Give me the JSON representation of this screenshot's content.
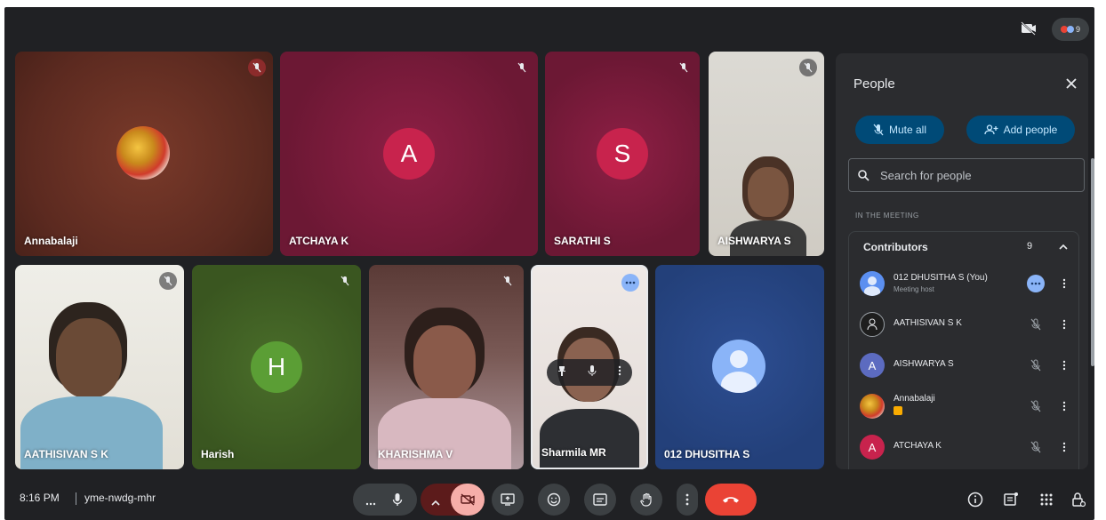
{
  "meeting": {
    "time": "8:16 PM",
    "code": "yme-nwdg-mhr"
  },
  "top": {
    "participant_count": "9"
  },
  "tiles": [
    {
      "name": "Annabalaji"
    },
    {
      "name": "ATCHAYA K",
      "initial": "A"
    },
    {
      "name": "SARATHI S",
      "initial": "S"
    },
    {
      "name": "AISHWARYA S"
    },
    {
      "name": "AATHISIVAN S K"
    },
    {
      "name": "Harish",
      "initial": "H"
    },
    {
      "name": "KHARISHMA V"
    },
    {
      "name": "Sharmila MR"
    },
    {
      "name": "012 DHUSITHA S"
    }
  ],
  "panel": {
    "title": "People",
    "mute_all": "Mute all",
    "add_people": "Add people",
    "search_placeholder": "Search for people",
    "section_label": "IN THE MEETING",
    "contributors_label": "Contributors",
    "contributors_count": "9",
    "people": [
      {
        "name": "012 DHUSITHA S (You)",
        "subtitle": "Meeting host"
      },
      {
        "name": "AATHISIVAN S K"
      },
      {
        "name": "AISHWARYA S",
        "initial": "A"
      },
      {
        "name": "Annabalaji"
      },
      {
        "name": "ATCHAYA K",
        "initial": "A"
      }
    ]
  },
  "colors": {
    "background": "#202124",
    "panel": "#2b2c2f",
    "accent_button": "#004a77",
    "end_call": "#ea4335",
    "camera_off": "#f6aea9"
  },
  "icons": [
    "camera-off-icon",
    "mic-off-icon",
    "mic-icon",
    "more-icon",
    "close-icon",
    "search-icon",
    "add-person-icon",
    "chevron-up-icon",
    "present-icon",
    "emoji-icon",
    "captions-icon",
    "hand-icon",
    "end-call-icon",
    "info-icon",
    "chat-icon",
    "activities-icon",
    "lock-icon"
  ]
}
